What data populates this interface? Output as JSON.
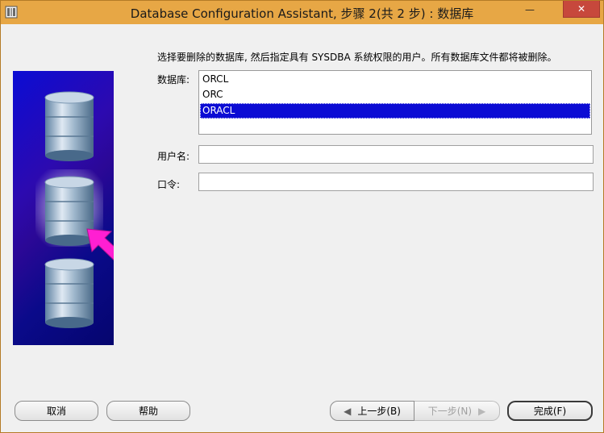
{
  "window": {
    "title": "Database Configuration Assistant, 步骤 2(共 2 步) : 数据库",
    "title_color": "#e7a745",
    "close_color": "#c7483c"
  },
  "form": {
    "instruction": "选择要删除的数据库, 然后指定具有 SYSDBA 系统权限的用户。所有数据库文件都将被删除。",
    "database_label": "数据库:",
    "databases": [
      {
        "name": "ORCL",
        "selected": false
      },
      {
        "name": "ORC",
        "selected": false
      },
      {
        "name": "ORACL",
        "selected": true
      }
    ],
    "username_label": "用户名:",
    "username_value": "",
    "password_label": "口令:",
    "password_value": ""
  },
  "buttons": {
    "cancel": "取消",
    "help": "帮助",
    "back": "上一步(B)",
    "next": "下一步(N)",
    "finish": "完成(F)"
  },
  "icons": {
    "minimize": "minimize-icon",
    "close": "close-icon",
    "back_arrow": "chevron-left-icon",
    "next_arrow": "chevron-right-icon"
  },
  "colors": {
    "selection": "#0c0cd4",
    "illustration_bg": "#1a0ab0",
    "pointer_arrow": "#ff1fd2"
  }
}
